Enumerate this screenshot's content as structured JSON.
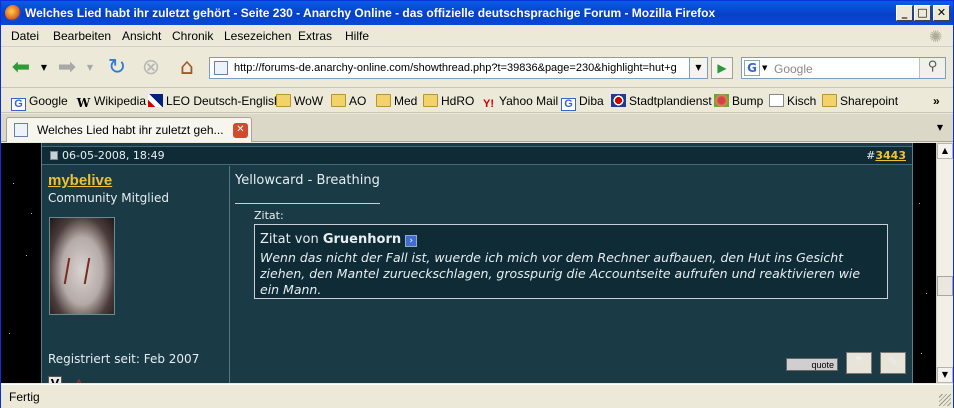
{
  "window": {
    "title": "Welches Lied habt ihr zuletzt gehört - Seite 230 - Anarchy Online - das offizielle deutschsprachige Forum - Mozilla Firefox"
  },
  "menu": [
    "Datei",
    "Bearbeiten",
    "Ansicht",
    "Chronik",
    "Lesezeichen",
    "Extras",
    "Hilfe"
  ],
  "nav": {
    "url": "http://forums-de.anarchy-online.com/showthread.php?t=39836&page=230&highlight=hut+g",
    "search_placeholder": "Google",
    "icons": [
      "back-icon",
      "forward-icon",
      "reload-icon",
      "stop-icon",
      "home-icon"
    ]
  },
  "bookmarks": [
    {
      "label": "Google",
      "icon": "google-icon"
    },
    {
      "label": "Wikipedia",
      "icon": "wikipedia-icon"
    },
    {
      "label": "LEO Deutsch-English",
      "icon": "leo-icon"
    },
    {
      "label": "WoW",
      "icon": "folder-icon"
    },
    {
      "label": "AO",
      "icon": "folder-icon"
    },
    {
      "label": "Med",
      "icon": "folder-icon"
    },
    {
      "label": "HdRO",
      "icon": "folder-icon"
    },
    {
      "label": "Yahoo Mail",
      "icon": "yahoo-icon"
    },
    {
      "label": "Diba",
      "icon": "google-icon"
    },
    {
      "label": "Stadtplandienst",
      "icon": "stadtplan-icon"
    },
    {
      "label": "Bump",
      "icon": "bump-icon"
    },
    {
      "label": "Kisch",
      "icon": "page-icon"
    },
    {
      "label": "Sharepoint",
      "icon": "folder-icon"
    }
  ],
  "tab": {
    "title": "Welches Lied habt ihr zuletzt geh..."
  },
  "post": {
    "date": "06-05-2008, 18:49",
    "number_prefix": "#",
    "number": "3443",
    "username": "mybelive",
    "rank": "Community Mitglied",
    "registered": "Registriert seit: Feb 2007",
    "message": "Yellowcard - Breathing",
    "quote_label": "Zitat:",
    "quote_prefix": "Zitat von ",
    "quote_author": "Gruenhorn",
    "quote_text": "Wenn das nicht der Fall ist, wuerde ich mich vor dem Rechner aufbauen, den Hut ins Gesicht ziehen, den Mantel zurueckschlagen, grosspurig die Accountseite aufrufen und reaktivieren wie ein Mann.",
    "quote_button": "quote"
  },
  "status": {
    "text": "Fertig"
  }
}
